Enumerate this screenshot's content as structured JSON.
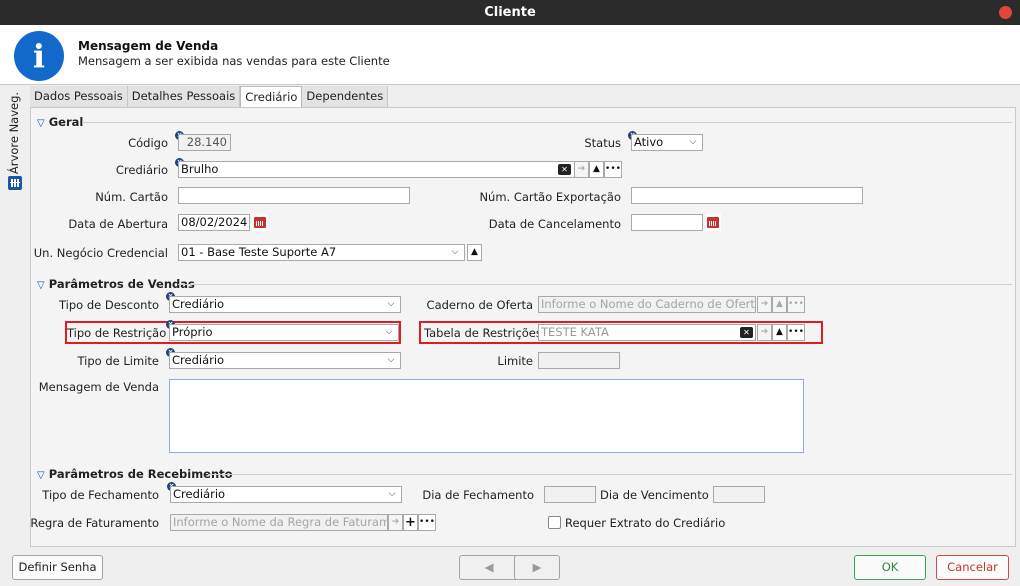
{
  "window": {
    "title": "Cliente"
  },
  "header": {
    "title": "Mensagem de Venda",
    "subtitle": "Mensagem a ser exibida nas vendas para este Cliente"
  },
  "sidebar": {
    "label": "Árvore Naveg."
  },
  "tabs": [
    {
      "label": "Dados Pessoais"
    },
    {
      "label": "Detalhes Pessoais"
    },
    {
      "label": "Crediário",
      "active": true
    },
    {
      "label": "Dependentes"
    }
  ],
  "geral": {
    "title": "Geral",
    "codigo_label": "Código",
    "codigo_value": "28.140",
    "status_label": "Status",
    "status_value": "Ativo",
    "crediario_label": "Crediário",
    "crediario_value": "Brulho",
    "num_cartao_label": "Núm. Cartão",
    "num_cartao_value": "",
    "num_cartao_exp_label": "Núm. Cartão Exportação",
    "num_cartao_exp_value": "",
    "data_abertura_label": "Data de Abertura",
    "data_abertura_value": "08/02/2024",
    "data_cancel_label": "Data de Cancelamento",
    "data_cancel_value": "",
    "un_negocio_label": "Un. Negócio Credencial",
    "un_negocio_value": "01 - Base Teste Suporte A7"
  },
  "vendas": {
    "title": "Parâmetros de Vendas",
    "tipo_desconto_label": "Tipo de Desconto",
    "tipo_desconto_value": "Crediário",
    "caderno_label": "Caderno de Oferta",
    "caderno_placeholder": "Informe o Nome do Caderno de Oferta",
    "tipo_restricao_label": "Tipo de Restrição",
    "tipo_restricao_value": "Próprio",
    "tabela_restricoes_label": "Tabela de Restrições",
    "tabela_restricoes_value": "TESTE KATA",
    "tipo_limite_label": "Tipo de Limite",
    "tipo_limite_value": "Crediário",
    "limite_label": "Limite",
    "limite_value": "",
    "mensagem_label": "Mensagem de Venda",
    "mensagem_value": ""
  },
  "recebimento": {
    "title": "Parâmetros de Recebimento",
    "tipo_fechamento_label": "Tipo de Fechamento",
    "tipo_fechamento_value": "Crediário",
    "dia_fechamento_label": "Dia de Fechamento",
    "dia_fechamento_value": "",
    "dia_vencimento_label": "Dia de Vencimento",
    "dia_vencimento_value": "",
    "regra_label": "Regra de Faturamento",
    "regra_placeholder": "Informe o Nome da Regra de Faturamento",
    "requer_extrato_label": "Requer Extrato do Crediário"
  },
  "footer": {
    "definir_senha": "Definir Senha",
    "ok": "OK",
    "cancelar": "Cancelar"
  },
  "colors": {
    "accent": "#1269c9",
    "highlight": "#e01b22",
    "ok": "#3aa84a",
    "cancel": "#d24a3e"
  }
}
